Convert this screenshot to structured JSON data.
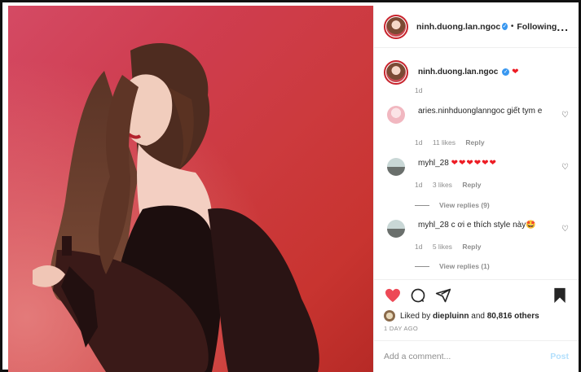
{
  "post": {
    "username": "ninh.duong.lan.ngoc",
    "following_label": "Following",
    "separator": "•",
    "more_label": "..."
  },
  "caption": {
    "username": "ninh.duong.lan.ngoc",
    "text": "❤",
    "time": "1d"
  },
  "comments": [
    {
      "username": "aries.ninhduonglanngoc",
      "text": "giết tym e",
      "time": "1d",
      "likes": "11 likes",
      "reply": "Reply"
    },
    {
      "username": "myhl_28",
      "text": "❤❤❤❤❤❤",
      "time": "1d",
      "likes": "3 likes",
      "reply": "Reply",
      "view_replies": "View replies (9)"
    },
    {
      "username": "myhl_28",
      "text": "c ơi e thích style này🤩",
      "time": "1d",
      "likes": "5 likes",
      "reply": "Reply",
      "view_replies": "View replies (1)"
    }
  ],
  "likes": {
    "prefix": "Liked by",
    "user": "diepluinn",
    "and": "and",
    "others": "80,816 others"
  },
  "date": "1 DAY AGO",
  "add_comment": {
    "placeholder": "Add a comment...",
    "post_label": "Post"
  },
  "colors": {
    "like_red": "#ed4956",
    "verified_blue": "#3897f0",
    "post_disabled": "#b2dffc"
  }
}
